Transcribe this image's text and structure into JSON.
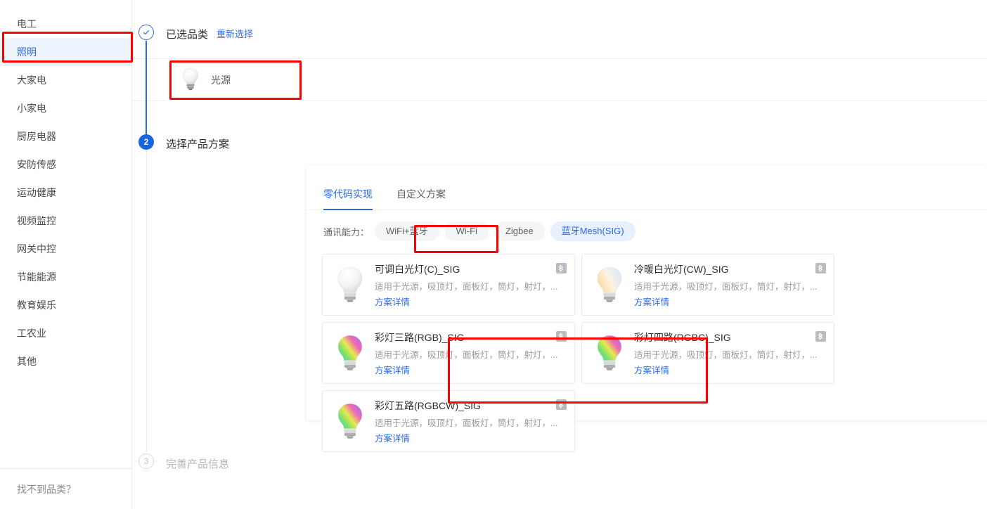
{
  "sidebar": {
    "items": [
      {
        "label": "电工",
        "active": false
      },
      {
        "label": "照明",
        "active": true
      },
      {
        "label": "大家电",
        "active": false
      },
      {
        "label": "小家电",
        "active": false
      },
      {
        "label": "厨房电器",
        "active": false
      },
      {
        "label": "安防传感",
        "active": false
      },
      {
        "label": "运动健康",
        "active": false
      },
      {
        "label": "视频监控",
        "active": false
      },
      {
        "label": "网关中控",
        "active": false
      },
      {
        "label": "节能能源",
        "active": false
      },
      {
        "label": "教育娱乐",
        "active": false
      },
      {
        "label": "工农业",
        "active": false
      },
      {
        "label": "其他",
        "active": false
      }
    ],
    "footer_label": "找不到品类？"
  },
  "steps": {
    "step1": {
      "title": "已选品类",
      "reselect_label": "重新选择",
      "state": "done"
    },
    "step2": {
      "number": "2",
      "title": "选择产品方案",
      "state": "current"
    },
    "step3": {
      "number": "3",
      "title": "完善产品信息",
      "state": "todo"
    }
  },
  "selected_category": {
    "label": "光源",
    "icon": "bulb-icon"
  },
  "panel": {
    "tabs": [
      {
        "label": "零代码实现",
        "active": true
      },
      {
        "label": "自定义方案",
        "active": false
      }
    ],
    "filter": {
      "label": "通讯能力：",
      "chips": [
        {
          "label": "WiFi+蓝牙",
          "selected": false
        },
        {
          "label": "Wi-Fi",
          "selected": false
        },
        {
          "label": "Zigbee",
          "selected": false
        },
        {
          "label": "蓝牙Mesh(SIG)",
          "selected": true
        }
      ]
    },
    "cards": [
      {
        "title": "可调白光灯(C)_SIG",
        "desc": "适用于光源，吸顶灯，面板灯，筒灯，射灯，...",
        "link": "方案详情",
        "badge": "bluetooth-icon",
        "bulb": "white",
        "selected": false
      },
      {
        "title": "冷暖白光灯(CW)_SIG",
        "desc": "适用于光源，吸顶灯，面板灯，筒灯，射灯，...",
        "link": "方案详情",
        "badge": "bluetooth-icon",
        "bulb": "warmcool",
        "selected": false
      },
      {
        "title": "彩灯三路(RGB)_SIG",
        "desc": "适用于光源，吸顶灯，面板灯，筒灯，射灯，...",
        "link": "方案详情",
        "badge": "bluetooth-icon",
        "bulb": "rgb",
        "selected": false
      },
      {
        "title": "彩灯四路(RGBC)_SIG",
        "desc": "适用于光源，吸顶灯，面板灯，筒灯，射灯，...",
        "link": "方案详情",
        "badge": "bluetooth-icon",
        "bulb": "rgb",
        "selected": false
      },
      {
        "title": "彩灯五路(RGBCW)_SIG",
        "desc": "适用于光源，吸顶灯，面板灯，筒灯，射灯，...",
        "link": "方案详情",
        "badge": "bluetooth-icon",
        "bulb": "rgb",
        "selected": true
      }
    ]
  },
  "colors": {
    "accent": "#2a6ae9",
    "accent_fill": "#1565e0",
    "accent_soft": "#e8f0fe",
    "sidebar_active_bg": "#eef4fe",
    "annotation": "#fe0000",
    "text_primary": "#2f2f2f",
    "text_muted": "#9a9a9a"
  }
}
